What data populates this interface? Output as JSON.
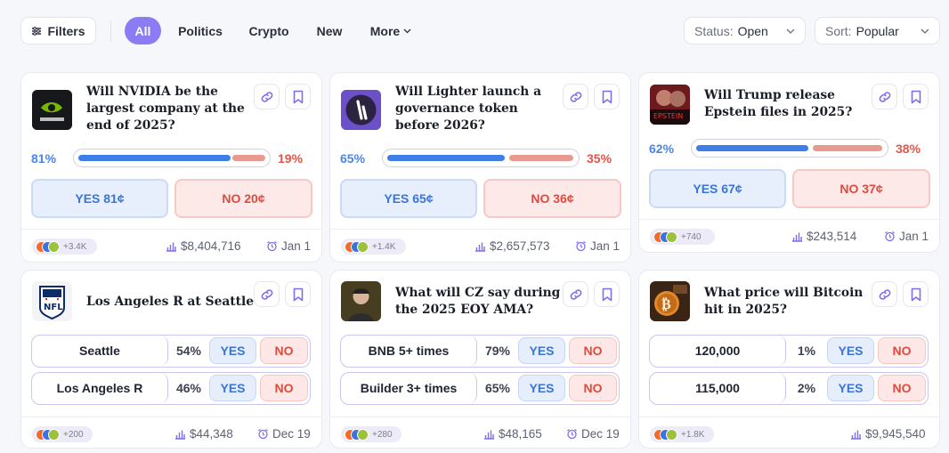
{
  "toolbar": {
    "filters_label": "Filters",
    "tabs": [
      "All",
      "Politics",
      "Crypto",
      "New",
      "More"
    ],
    "status_label": "Status:",
    "status_value": "Open",
    "sort_label": "Sort:",
    "sort_value": "Popular"
  },
  "colors": {
    "accent": "#8b7cf4",
    "yes": "#4a86e8",
    "no": "#e25548"
  },
  "cards": [
    {
      "title": "Will NVIDIA be the largest company at the end of 2025?",
      "thumb": "nvidia-logo",
      "yes_pct": "81%",
      "no_pct": "19%",
      "yes_share": 0.81,
      "yes_btn": "YES 81¢",
      "no_btn": "NO 20¢",
      "traders": "+3.4K",
      "volume": "$8,404,716",
      "date": "Jan 1"
    },
    {
      "title": "Will Lighter launch a governance token before 2026?",
      "thumb": "lighter-logo",
      "yes_pct": "65%",
      "no_pct": "35%",
      "yes_share": 0.65,
      "yes_btn": "YES 65¢",
      "no_btn": "NO 36¢",
      "traders": "+1.4K",
      "volume": "$2,657,573",
      "date": "Jan 1"
    },
    {
      "title": "Will Trump release Epstein files in 2025?",
      "thumb": "epstein-image",
      "yes_pct": "62%",
      "no_pct": "38%",
      "yes_share": 0.62,
      "yes_btn": "YES 67¢",
      "no_btn": "NO 37¢",
      "traders": "+740",
      "volume": "$243,514",
      "date": "Jan 1"
    },
    {
      "title": "Los Angeles R at Seattle",
      "thumb": "nfl-logo",
      "outcomes": [
        {
          "label": "Seattle",
          "pct": "54%",
          "yes": "YES",
          "no": "NO"
        },
        {
          "label": "Los Angeles R",
          "pct": "46%",
          "yes": "YES",
          "no": "NO"
        }
      ],
      "traders": "+200",
      "volume": "$44,348",
      "date": "Dec 19"
    },
    {
      "title": "What will CZ say during the 2025 EOY AMA?",
      "thumb": "cz-photo",
      "outcomes": [
        {
          "label": "BNB 5+ times",
          "pct": "79%",
          "yes": "YES",
          "no": "NO"
        },
        {
          "label": "Builder 3+ times",
          "pct": "65%",
          "yes": "YES",
          "no": "NO"
        }
      ],
      "traders": "+280",
      "volume": "$48,165",
      "date": "Dec 19"
    },
    {
      "title": "What price will Bitcoin hit in 2025?",
      "thumb": "bitcoin-image",
      "outcomes": [
        {
          "label": "120,000",
          "pct": "1%",
          "yes": "YES",
          "no": "NO"
        },
        {
          "label": "115,000",
          "pct": "2%",
          "yes": "YES",
          "no": "NO"
        }
      ],
      "traders": "+1.8K",
      "volume": "$9,945,540",
      "date": ""
    }
  ]
}
